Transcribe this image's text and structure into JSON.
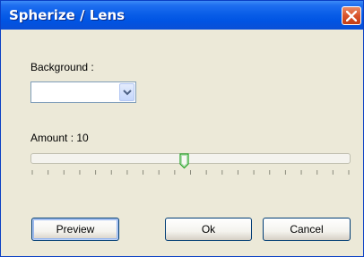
{
  "window": {
    "title": "Spherize / Lens",
    "close_icon": "close-icon"
  },
  "background": {
    "label": "Background :",
    "selected_value": "",
    "dropdown_icon": "chevron-down-icon"
  },
  "amount": {
    "label": "Amount : 10",
    "value": 10,
    "slider_fraction": 0.48
  },
  "buttons": {
    "preview": "Preview",
    "ok": "Ok",
    "cancel": "Cancel"
  },
  "colors": {
    "titlebar": "#0054e3",
    "close_button": "#d9542c",
    "dialog_face": "#ece9d8",
    "button_border": "#003c74",
    "thumb": "#21a121"
  }
}
